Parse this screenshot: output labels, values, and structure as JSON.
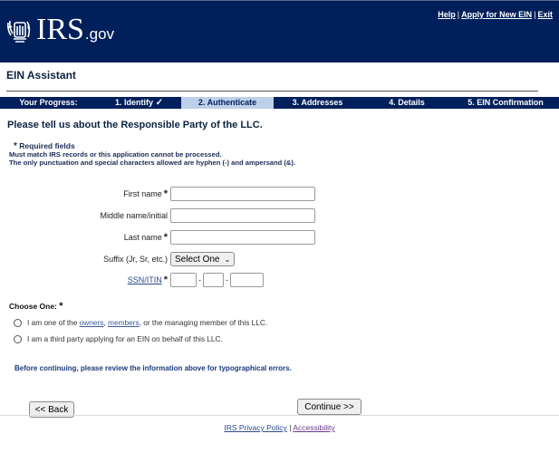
{
  "header": {
    "logo_text": "IRS",
    "logo_suffix": ".gov",
    "links": [
      {
        "label": "Help"
      },
      {
        "label": "Apply for New EIN"
      },
      {
        "label": "Exit"
      }
    ],
    "separator": "|"
  },
  "app_title": "EIN Assistant",
  "progress": {
    "label": "Your Progress:",
    "steps": [
      {
        "label": "1. Identify",
        "status": "complete",
        "check": "✓"
      },
      {
        "label": "2. Authenticate",
        "status": "active"
      },
      {
        "label": "3. Addresses",
        "status": "pending"
      },
      {
        "label": "4. Details",
        "status": "pending"
      },
      {
        "label": "5. EIN Confirmation",
        "status": "pending"
      }
    ],
    "active_color": "#bcd0e9",
    "bar_color": "#00205b"
  },
  "section_heading": "Please tell us about the Responsible Party of the LLC.",
  "notes": {
    "required_marker": "*",
    "required_text": "Required fields",
    "line1": "Must match IRS records or this application cannot be processed.",
    "line2": "The only punctuation and special characters allowed are hyphen (-) and ampersand (&)."
  },
  "form": {
    "first_name": {
      "label": "First name",
      "required": "*",
      "value": ""
    },
    "middle_name": {
      "label": "Middle name/initial",
      "value": ""
    },
    "last_name": {
      "label": "Last name",
      "required": "*",
      "value": ""
    },
    "suffix": {
      "label": "Suffix (Jr, Sr, etc.)",
      "selected": "Select One"
    },
    "ssn": {
      "label": "SSN/ITIN",
      "required": "*",
      "part1": "",
      "part2": "",
      "part3": "",
      "separator": "-"
    }
  },
  "choose": {
    "label": "Choose One:",
    "required": "*",
    "options": [
      {
        "prefix": "I am one of the ",
        "link1": "owners",
        "comma": ", ",
        "link2": "members",
        "suffix": ", or the managing member of this LLC.",
        "selected": false
      },
      {
        "text": "I am a third party applying for an EIN on behalf of this LLC.",
        "selected": false
      }
    ]
  },
  "review_text": "Before continuing, please review the information above for typographical errors.",
  "buttons": {
    "back": "<< Back",
    "continue": "Continue >>"
  },
  "footer": {
    "privacy": "IRS Privacy Policy",
    "separator": "|",
    "accessibility": "Accessibility"
  }
}
